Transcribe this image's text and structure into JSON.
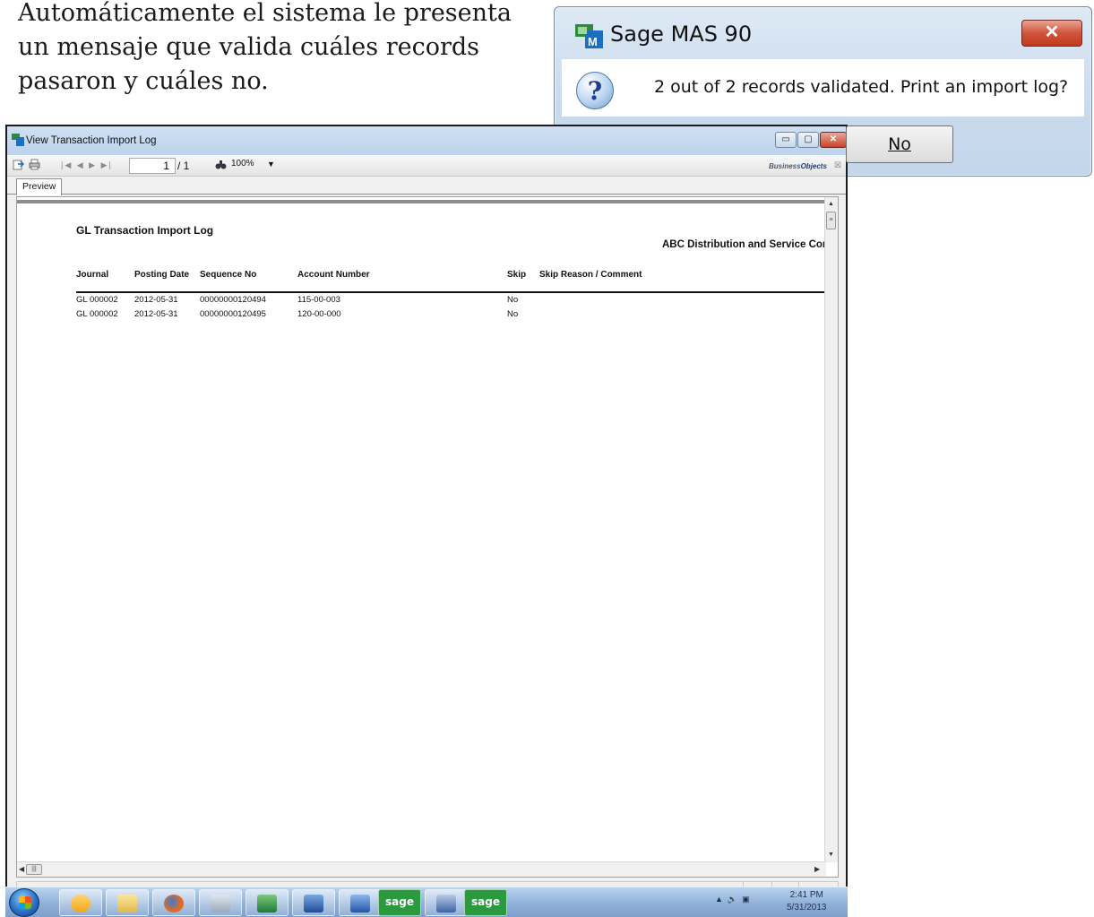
{
  "doc_text": {
    "lines": [
      "Automáticamente el sistema le presenta",
      "un mensaje que valida cuáles records",
      "pasaron y cuáles no."
    ]
  },
  "dialog": {
    "title": "Sage MAS 90",
    "close_label": "✕",
    "message": "2 out of 2 records validated.  Print an import log?",
    "icon": "question-icon",
    "no_button": "No"
  },
  "window": {
    "title": "View Transaction Import Log",
    "controls": {
      "minimize": "▭",
      "maximize": "▢",
      "close": "✕"
    },
    "toolbar": {
      "page_current": "1",
      "page_total": "/ 1",
      "zoom": "100%",
      "brand_prefix": "Business",
      "brand_suffix": "Objects",
      "nav": "|◀ ◀ ▶ ▶|"
    },
    "tabs": [
      {
        "label": "Preview"
      }
    ]
  },
  "report": {
    "title": "GL Transaction Import Log",
    "company": "ABC Distribution and Service Corp.",
    "headers": {
      "journal": "Journal",
      "posting_date": "Posting Date",
      "sequence_no": "Sequence No",
      "account_number": "Account Number",
      "skip": "Skip",
      "skip_reason": "Skip Reason / Comment"
    },
    "rows": [
      {
        "journal": "GL  000002",
        "posting_date": "2012-05-31",
        "sequence_no": "00000000120494",
        "account_number": "115-00-003",
        "skip": "No",
        "skip_reason": ""
      },
      {
        "journal": "GL  000002",
        "posting_date": "2012-05-31",
        "sequence_no": "00000000120495",
        "account_number": "120-00-000",
        "skip": "No",
        "skip_reason": ""
      }
    ]
  },
  "taskbar": {
    "apps": [
      "outlook",
      "explorer",
      "firefox",
      "calculator",
      "excel",
      "network",
      "word",
      "sage",
      "sage-import",
      "sage"
    ],
    "sage_label": "sage",
    "time": "2:41 PM",
    "date": "5/31/2013"
  },
  "colors": {
    "titlebar": "#c9daec",
    "close_red": "#c9432b",
    "taskbar": "#8fb0d8"
  }
}
